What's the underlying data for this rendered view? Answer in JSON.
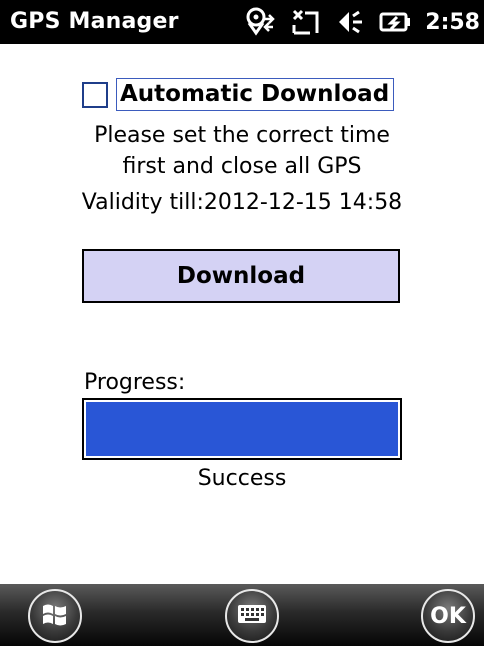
{
  "statusbar": {
    "title": "GPS Manager",
    "time": "2:58",
    "icons": [
      "gps-connectivity-icon",
      "no-signal-icon",
      "volume-icon",
      "battery-charging-icon"
    ]
  },
  "form": {
    "auto_download_label": "Automatic Download",
    "auto_download_checked": false,
    "instruction_line1": "Please set the correct time",
    "instruction_line2": "first and close all GPS",
    "validity": "Validity till:2012-12-15 14:58",
    "download_button": "Download",
    "progress_label": "Progress:",
    "progress_value": 1.0,
    "progress_status": "Success",
    "progress_color": "#2956d6",
    "button_color": "#d4d2f4"
  },
  "bottombar": {
    "start_icon": "windows-logo-icon",
    "keyboard_icon": "keyboard-icon",
    "ok_label": "OK"
  }
}
